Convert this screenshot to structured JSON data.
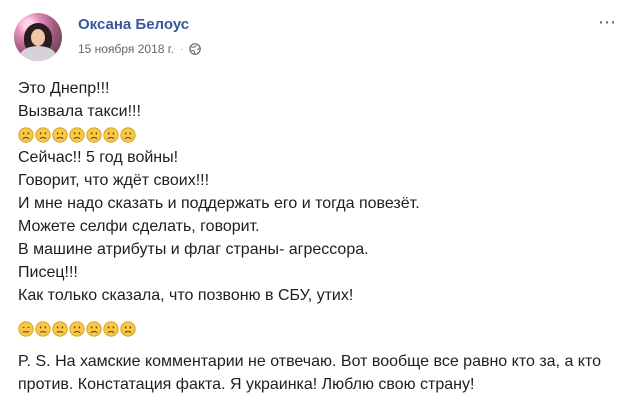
{
  "post": {
    "author": "Оксана Белоус",
    "date": "15 ноября 2018 г.",
    "separator": "·",
    "privacy_icon": "globe-icon",
    "menu_icon": "more-horizontal-icon",
    "menu_glyph": "⋯",
    "lines": [
      "Это Днепр!!!",
      "Вызвала такси!!!"
    ],
    "emoji_row_1": [
      "frowning-face",
      "frowning-face",
      "frowning-face",
      "frowning-face",
      "frowning-face",
      "frowning-face",
      "frowning-face"
    ],
    "lines_2": [
      "Сейчас!! 5 год войны!",
      "Говорит, что ждёт своих!!!",
      "И мне надо сказать и поддержать его и тогда повезёт.",
      "Можете селфи сделать, говорит.",
      "В машине атрибуты и флаг страны- агрессора.",
      "Писец!!!",
      "Как только сказала, что позвоню в СБУ, утих!"
    ],
    "emoji_row_2": [
      "expressionless-face",
      "confused-face",
      "confused-face",
      "frowning-face",
      "frowning-face",
      "frowning-face",
      "frowning-face"
    ],
    "ps": "P. S. На хамские комментарии не отвечаю. Вот вообще все равно кто за, а кто против. Констатация факта. Я украинка! Люблю свою страну!"
  },
  "colors": {
    "name": "#385898",
    "meta": "#606770",
    "text": "#1c1e21",
    "emoji_face": "#f7c948",
    "emoji_outline": "#d39b1a",
    "emoji_feature": "#6b4a1a"
  }
}
